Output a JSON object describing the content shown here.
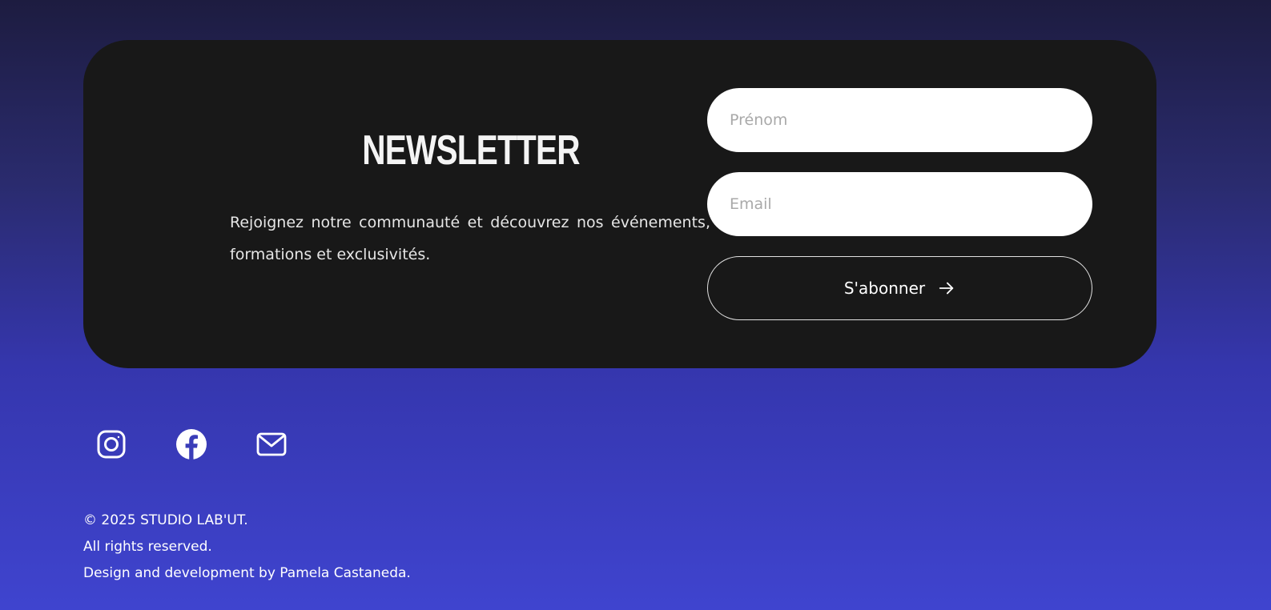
{
  "newsletter": {
    "title": "NEWSLETTER",
    "description": "Rejoignez notre communauté et découvrez nos événements, formations et exclusivités.",
    "fields": {
      "first_name_placeholder": "Prénom",
      "email_placeholder": "Email"
    },
    "subscribe_label": "S'abonner",
    "subscribe_icon": "arrow-right-icon"
  },
  "social": {
    "items": [
      {
        "name": "instagram",
        "icon": "instagram-icon"
      },
      {
        "name": "facebook",
        "icon": "facebook-icon"
      },
      {
        "name": "email",
        "icon": "mail-icon"
      }
    ]
  },
  "footer": {
    "copyright": "© 2025 STUDIO LAB'UT.",
    "rights": "All rights reserved.",
    "credits": "Design and development by Pamela Castaneda."
  },
  "colors": {
    "card_background": "#181818",
    "gradient_top": "#1d1c40",
    "gradient_bottom": "#3f44cf",
    "text": "#ffffff"
  }
}
